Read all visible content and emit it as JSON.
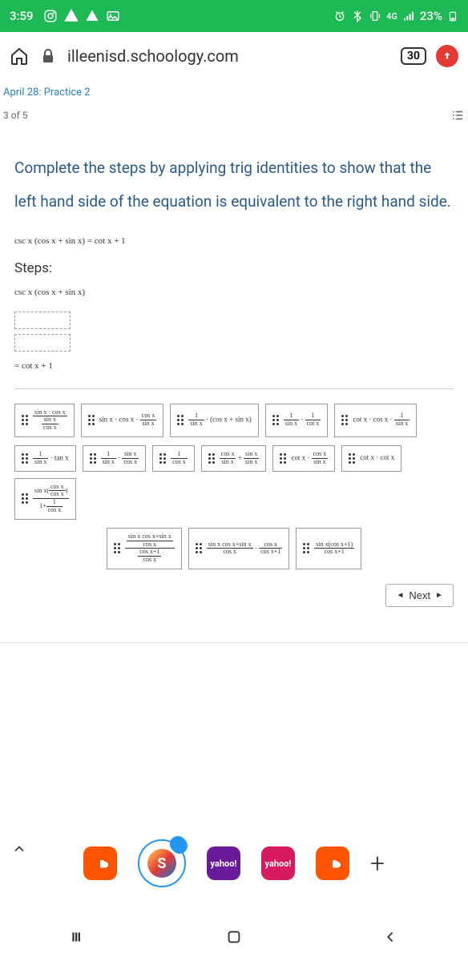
{
  "status": {
    "time": "3:59",
    "battery": "23%",
    "network": "4G"
  },
  "browser": {
    "url": "illeenisd.schoology.com",
    "tab_count": "30"
  },
  "breadcrumb": "April 28: Practice 2",
  "progress": "3 of 5",
  "instruction": "Complete the steps by applying trig identities to show that the left hand side of the equation is equivalent to the right hand side.",
  "equation_given": "csc x (cos x + sin x) = cot x + 1",
  "steps_label": "Steps:",
  "step_start": "csc x (cos x + sin x)",
  "step_end": "= cot x + 1",
  "tiles": {
    "r1": [
      "sin x · cos x / (sin x / cos x)",
      "sin x · cos x · (cos x / sin x)",
      "1/sin x · (cos x + sin x)",
      "1/sin x · 1/cot x",
      "cot x · cos x · 1/sin x"
    ],
    "r2": [
      "1/sin x · tan x",
      "1/sin x · sin x/cos x",
      "1/cos x",
      "cos x/sin x + sin x/sin x",
      "cot x · cos x/sin x",
      "cot x · cot x",
      "sin x(cos x/cos x) / 1+1/cos x"
    ],
    "r3": [
      "sin x cos x+sin x / cos x · cos x+1/cos x",
      "sin x cos x+sin x / cos x · cos x/cos x+1",
      "sin x(cos x+1) / cos x+1"
    ]
  },
  "next_label": "Next",
  "dock": {
    "s_x": "✕"
  },
  "plus": "+"
}
